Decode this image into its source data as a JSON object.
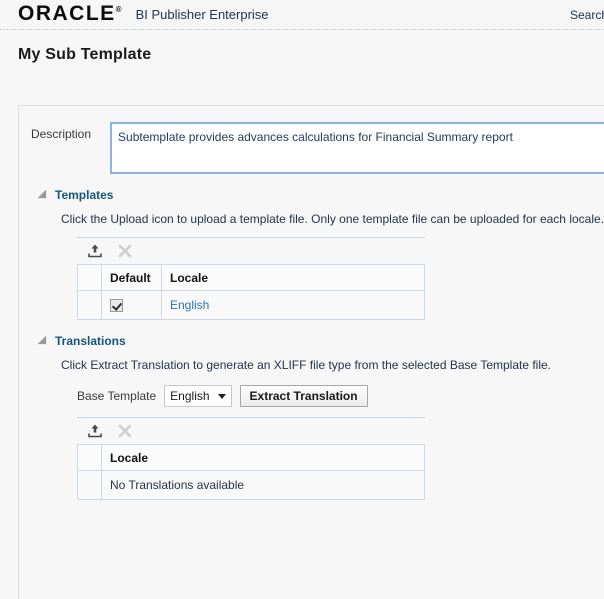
{
  "header": {
    "logo": "ORACLE",
    "logo_tm": "®",
    "app_name": "BI Publisher Enterprise",
    "search_label": "Search"
  },
  "page": {
    "title": "My Sub Template"
  },
  "description": {
    "label": "Description",
    "value": "Subtemplate provides advances calculations for Financial Summary report",
    "placeholder": ""
  },
  "templates_section": {
    "title": "Templates",
    "hint": "Click the Upload icon to upload a template file. Only one template file can be uploaded for each locale.",
    "toolbar": {
      "upload_icon": "upload-icon",
      "delete_icon": "delete-icon"
    },
    "table": {
      "columns": [
        "",
        "Default",
        "Locale"
      ],
      "rows": [
        {
          "default_checked": true,
          "locale": "English"
        }
      ]
    }
  },
  "translations_section": {
    "title": "Translations",
    "hint": "Click Extract Translation to generate an XLIFF file type from the selected Base Template file.",
    "base_template_label": "Base Template",
    "base_template_value": "English",
    "extract_button_label": "Extract Translation",
    "toolbar": {
      "upload_icon": "upload-icon",
      "delete_icon": "delete-icon"
    },
    "table": {
      "columns": [
        "",
        "Locale"
      ],
      "empty_message": "No Translations available"
    }
  },
  "colors": {
    "link": "#2f72b8",
    "section_title": "#16557f",
    "focus_border": "#8ab4e8",
    "panel_border": "#d6dee2"
  }
}
